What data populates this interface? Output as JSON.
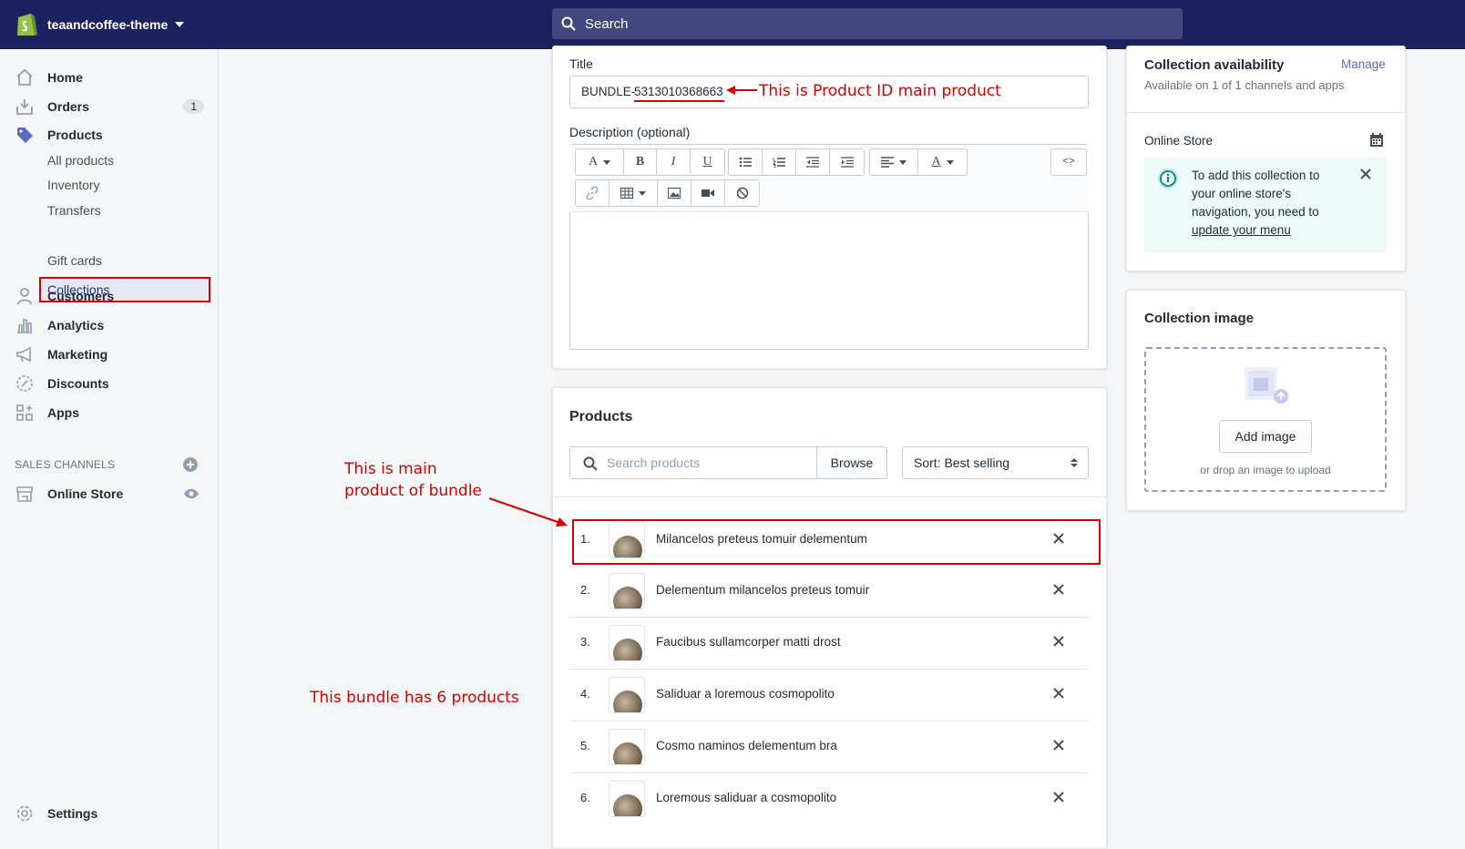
{
  "topbar": {
    "store_name": "teaandcoffee-theme",
    "search_placeholder": "Search"
  },
  "sidebar": {
    "items": [
      {
        "label": "Home",
        "icon": "home-icon"
      },
      {
        "label": "Orders",
        "icon": "orders-icon",
        "badge": "1"
      },
      {
        "label": "Products",
        "icon": "tag-icon"
      },
      {
        "label": "Customers",
        "icon": "person-icon"
      },
      {
        "label": "Analytics",
        "icon": "bar-chart-icon"
      },
      {
        "label": "Marketing",
        "icon": "megaphone-icon"
      },
      {
        "label": "Discounts",
        "icon": "discount-icon"
      },
      {
        "label": "Apps",
        "icon": "apps-icon"
      }
    ],
    "product_sub_items": [
      "All products",
      "Inventory",
      "Transfers",
      "Collections",
      "Gift cards"
    ],
    "sales_channels_title": "SALES CHANNELS",
    "online_store": "Online Store",
    "settings": "Settings"
  },
  "main": {
    "title_label": "Title",
    "title_value_prefix": "BUNDLE-",
    "title_value_id": "5313010368663",
    "description_label": "Description (optional)",
    "products_title": "Products",
    "search_products_placeholder": "Search products",
    "browse_label": "Browse",
    "sort_label": "Sort: Best selling",
    "products": [
      {
        "num": "1.",
        "name": "Milancelos preteus tomuir delementum"
      },
      {
        "num": "2.",
        "name": "Delementum milancelos preteus tomuir"
      },
      {
        "num": "3.",
        "name": "Faucibus sullamcorper matti drost"
      },
      {
        "num": "4.",
        "name": "Saliduar a loremous cosmopolito"
      },
      {
        "num": "5.",
        "name": "Cosmo naminos delementum bra"
      },
      {
        "num": "6.",
        "name": "Loremous saliduar a cosmopolito"
      }
    ]
  },
  "right": {
    "availability_title": "Collection availability",
    "manage_label": "Manage",
    "availability_sub": "Available on 1 of 1 channels and apps",
    "online_store_label": "Online Store",
    "notice_text": "To add this collection to your online store's navigation, you need to",
    "notice_link": "update your menu",
    "image_title": "Collection image",
    "add_image_label": "Add image",
    "drop_text": "or drop an image to upload"
  },
  "annotations": {
    "product_id_note": "This is Product ID main product",
    "main_product_line1": "This is main",
    "main_product_line2": "product of bundle",
    "bundle_count": "This bundle has 6 products"
  },
  "colors": {
    "topbar": "#1c2260",
    "annotation": "#d60000",
    "link": "#5c6ac4",
    "notice_bg": "#eef9f9"
  }
}
